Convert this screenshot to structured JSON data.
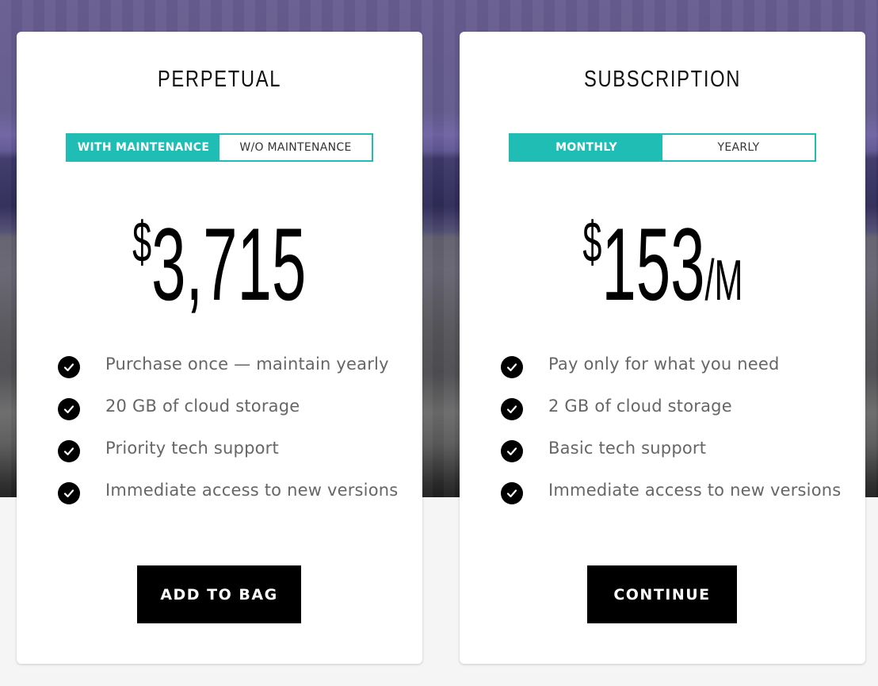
{
  "plans": [
    {
      "title": "PERPETUAL",
      "toggle": {
        "options": [
          "WITH MAINTENANCE",
          "W/O MAINTENANCE"
        ],
        "selected": "WITH MAINTENANCE"
      },
      "price": {
        "currency": "$",
        "amount": "3,715",
        "period": ""
      },
      "features": [
        "Purchase once — maintain yearly",
        "20 GB of cloud storage",
        "Priority tech support",
        "Immediate access to new versions"
      ],
      "cta": "ADD TO BAG"
    },
    {
      "title": "SUBSCRIPTION",
      "toggle": {
        "options": [
          "MONTHLY",
          "YEARLY"
        ],
        "selected": "MONTHLY"
      },
      "price": {
        "currency": "$",
        "amount": "153",
        "period": "/M"
      },
      "features": [
        "Pay only for what you need",
        "2 GB of cloud storage",
        "Basic tech support",
        "Immediate access to new versions"
      ],
      "cta": "CONTINUE"
    }
  ],
  "colors": {
    "accent": "#1fbdb4",
    "button": "#000000",
    "feature_text": "#666666"
  },
  "icons": {
    "feature": "check-circle-icon"
  }
}
